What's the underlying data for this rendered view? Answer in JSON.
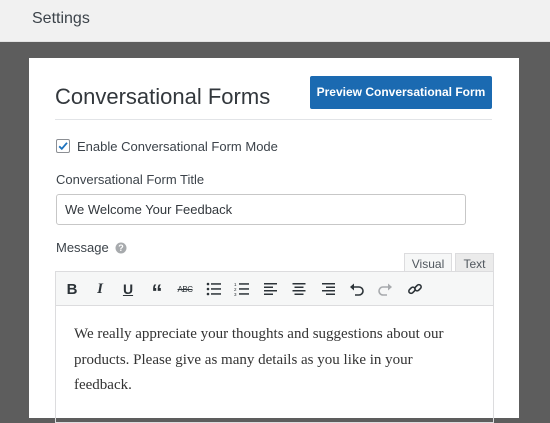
{
  "topbar": {
    "title": "Settings"
  },
  "panel": {
    "title": "Conversational Forms",
    "preview_button": "Preview Conversational Form",
    "enable_checkbox": {
      "label": "Enable Conversational Form Mode",
      "checked": true
    },
    "form_title": {
      "label": "Conversational Form Title",
      "value": "We Welcome Your Feedback"
    },
    "message": {
      "label": "Message",
      "tabs": [
        "Visual",
        "Text"
      ],
      "active_tab": "Visual",
      "content": "We really appreciate your thoughts and suggestions about our products. Please give as many details as you like in your feedback."
    }
  },
  "toolbar_icons": [
    "bold-icon",
    "italic-icon",
    "underline-icon",
    "blockquote-icon",
    "strikethrough-icon",
    "bullet-list-icon",
    "numbered-list-icon",
    "align-left-icon",
    "align-center-icon",
    "align-right-icon",
    "undo-icon",
    "redo-icon",
    "link-icon"
  ],
  "colors": {
    "accent": "#1b6ab1",
    "backdrop": "#5d5d5d",
    "panel": "#ffffff",
    "toolbar": "#f6f7f7"
  }
}
